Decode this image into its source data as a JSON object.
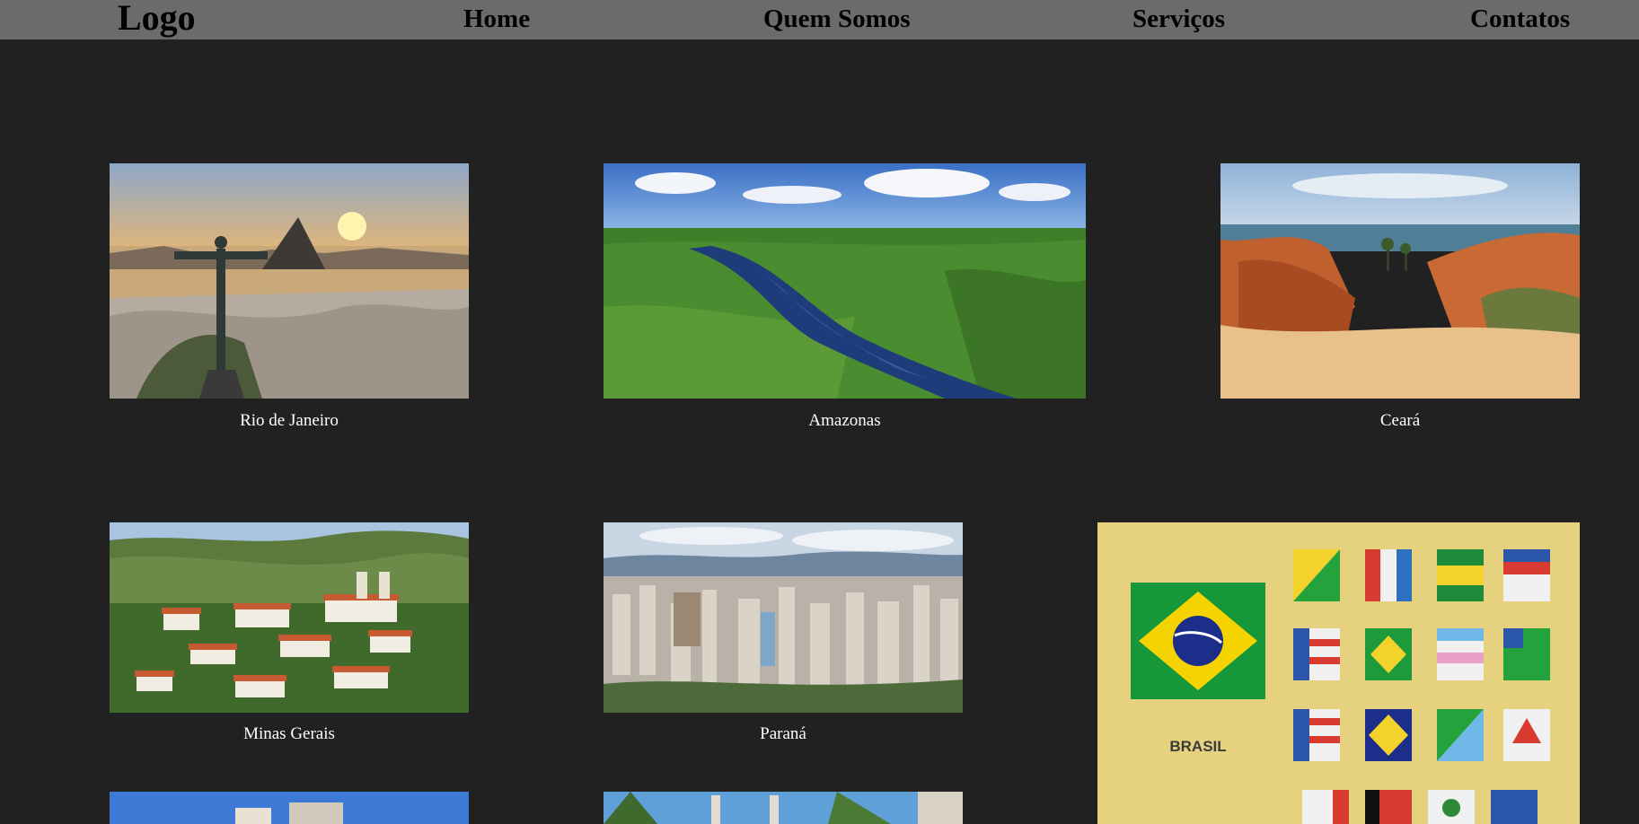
{
  "nav": {
    "logo": "Logo",
    "items": [
      "Home",
      "Quem Somos",
      "Serviços",
      "Contatos"
    ]
  },
  "cards": [
    {
      "caption": "Rio de Janeiro",
      "image": "rio-de-janeiro-christ-the-redeemer-photo"
    },
    {
      "caption": "Amazonas",
      "image": "amazon-river-rainforest-photo"
    },
    {
      "caption": "Ceará",
      "image": "ceara-red-cliffs-beach-photo"
    },
    {
      "caption": "Minas Gerais",
      "image": "minas-gerais-colonial-town-photo"
    },
    {
      "caption": "Paraná",
      "image": "parana-city-skyline-photo"
    }
  ],
  "flags_panel": {
    "label": "BRASIL",
    "image": "brazil-state-flags-poster"
  },
  "colors": {
    "page_background": "#212121",
    "nav_background": "#6b6b6b",
    "nav_text": "#000000",
    "caption_text": "#ffffff",
    "flags_background": "#e6d27e"
  }
}
